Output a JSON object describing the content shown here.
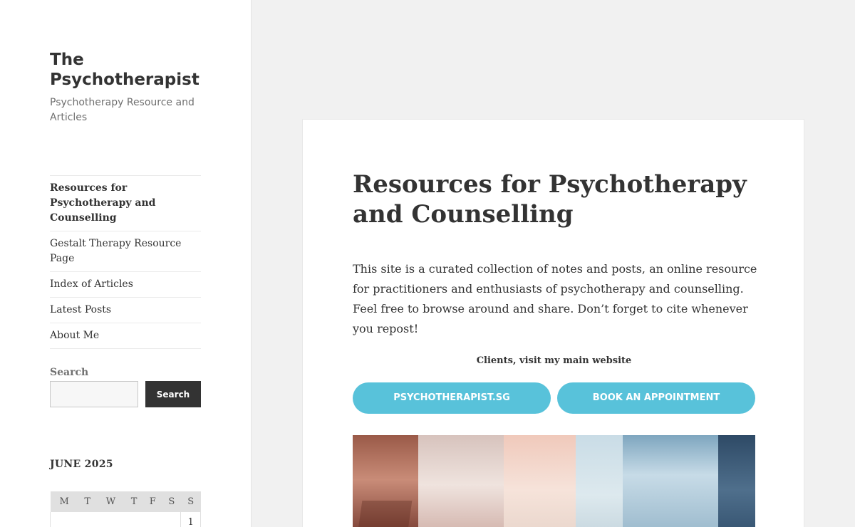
{
  "site": {
    "title": "The Psychotherapist",
    "description": "Psychotherapy Resource and Articles"
  },
  "nav": {
    "items": [
      {
        "label": "Resources for Psychotherapy and Counselling",
        "current": true
      },
      {
        "label": "Gestalt Therapy Resource Page"
      },
      {
        "label": "Index of Articles"
      },
      {
        "label": "Latest Posts"
      },
      {
        "label": "About Me"
      }
    ]
  },
  "search": {
    "label": "Search",
    "input_value": "",
    "button_label": "Search"
  },
  "calendar": {
    "title": "JUNE 2025",
    "weekdays": [
      "M",
      "T",
      "W",
      "T",
      "F",
      "S",
      "S"
    ],
    "first_row": [
      "",
      "",
      "",
      "",
      "",
      "",
      "1"
    ]
  },
  "entry": {
    "title": "Resources for Psychotherapy and Counselling",
    "body": "This site is a curated collection of notes and posts, an online resource for practitioners and enthusiasts of psychotherapy and counselling. Feel free to browse around and share. Don’t forget to cite whenever you repost!",
    "clients_note": "Clients, visit my main website",
    "button_site": "PSYCHOTHERAPIST.SG",
    "button_appointment": "BOOK AN APPOINTMENT"
  },
  "colors": {
    "accent_button": "#58c2da",
    "search_button": "#333333",
    "page_background": "#f1f1f1"
  }
}
